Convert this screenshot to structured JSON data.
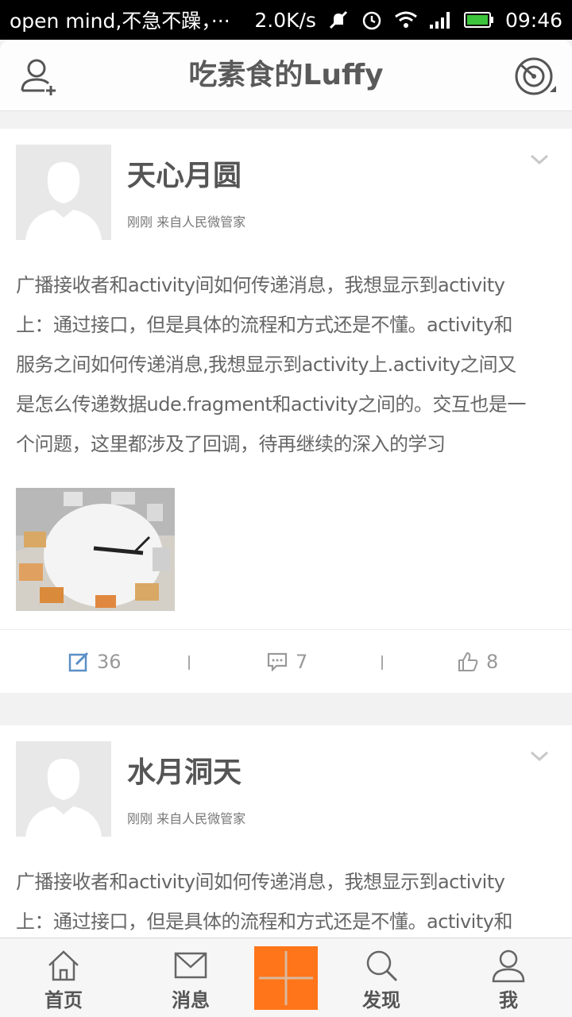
{
  "status_bar": {
    "notification": "open mind,不急不躁，···",
    "speed": "2.0K/s",
    "time": "09:46",
    "icons": [
      "mute-icon",
      "alarm-icon",
      "wifi-icon",
      "signal-icon",
      "battery-icon"
    ]
  },
  "header": {
    "title": "吃素食的Luffy",
    "left_icon": "add-friend-icon",
    "right_icon": "radar-icon"
  },
  "posts": [
    {
      "author": "天心月圆",
      "meta": "刚刚 来自人民微管家",
      "lines": [
        "广播接收者和activity间如何传递消息，我想显示到activity",
        "上：通过接口，但是具体的流程和方式还是不懂。activity和",
        "服务之间如何传递消息,我想显示到activity上.activity之间又",
        "是怎么传递数据ude.fragment和activity之间的。交互也是一",
        "个问题，这里都涉及了回调，待再继续的深入的学习"
      ],
      "image": "clock-with-furniture-image",
      "repost_count": "36",
      "comment_count": "7",
      "like_count": "8"
    },
    {
      "author": "水月洞天",
      "meta": "刚刚 来自人民微管家",
      "lines": [
        "广播接收者和activity间如何传递消息，我想显示到activity",
        "上：通过接口，但是具体的流程和方式还是不懂。activity和"
      ]
    }
  ],
  "bottom_nav": {
    "items": [
      {
        "label": "首页",
        "icon": "home-icon"
      },
      {
        "label": "消息",
        "icon": "mail-icon"
      },
      {
        "label": "",
        "icon": "plus-icon"
      },
      {
        "label": "发现",
        "icon": "search-icon"
      },
      {
        "label": "我",
        "icon": "user-icon"
      }
    ]
  },
  "colors": {
    "accent": "#ff7519",
    "action_blue": "#5b8fc7",
    "text": "#555555"
  }
}
